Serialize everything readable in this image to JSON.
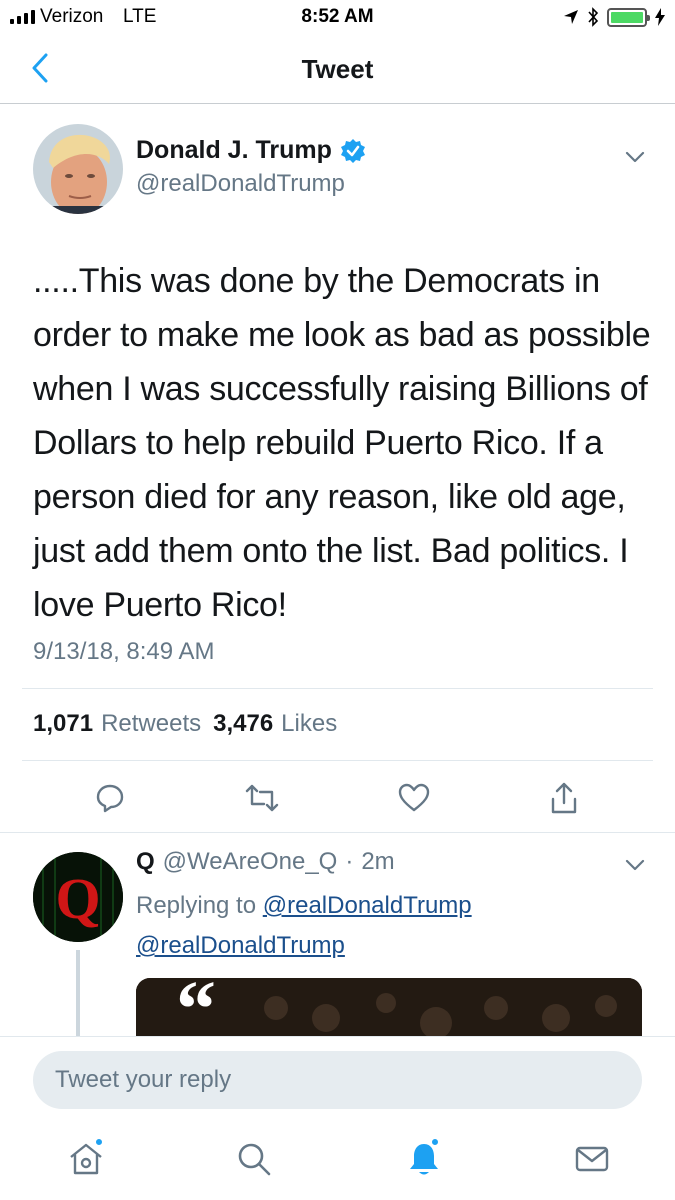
{
  "status_bar": {
    "carrier": "Verizon",
    "network": "LTE",
    "time": "8:52 AM",
    "battery_color": "#4cd964"
  },
  "nav": {
    "title": "Tweet",
    "back_icon": "chevron-left-icon"
  },
  "tweet": {
    "author_name": "Donald J. Trump",
    "verified": true,
    "handle": "@realDonaldTrump",
    "text": ".....This was done by the Democrats in order to make me look as bad as possible when I was successfully raising Billions of Dollars to help rebuild Puerto Rico. If a person died for any reason, like old age, just add them onto the list. Bad politics. I love Puerto Rico!",
    "timestamp": "9/13/18, 8:49 AM",
    "retweets_count": "1,071",
    "retweets_label": "Retweets",
    "likes_count": "3,476",
    "likes_label": "Likes"
  },
  "actions": {
    "reply_icon": "reply-icon",
    "retweet_icon": "retweet-icon",
    "like_icon": "heart-icon",
    "share_icon": "share-icon"
  },
  "reply": {
    "name": "Q",
    "handle": "@WeAreOne_Q",
    "separator": "·",
    "time": "2m",
    "replying_to_label": "Replying to",
    "replying_to_handle": "@realDonaldTrump",
    "body_mention": "@realDonaldTrump",
    "avatar_letter": "Q"
  },
  "composer": {
    "placeholder": "Tweet your reply"
  },
  "tab_bar": {
    "tabs": [
      "home-icon",
      "search-icon",
      "notifications-icon",
      "messages-icon"
    ]
  },
  "colors": {
    "accent": "#1da1f2",
    "text_primary": "#14171a",
    "text_secondary": "#657786",
    "verified": "#1da1f2"
  }
}
